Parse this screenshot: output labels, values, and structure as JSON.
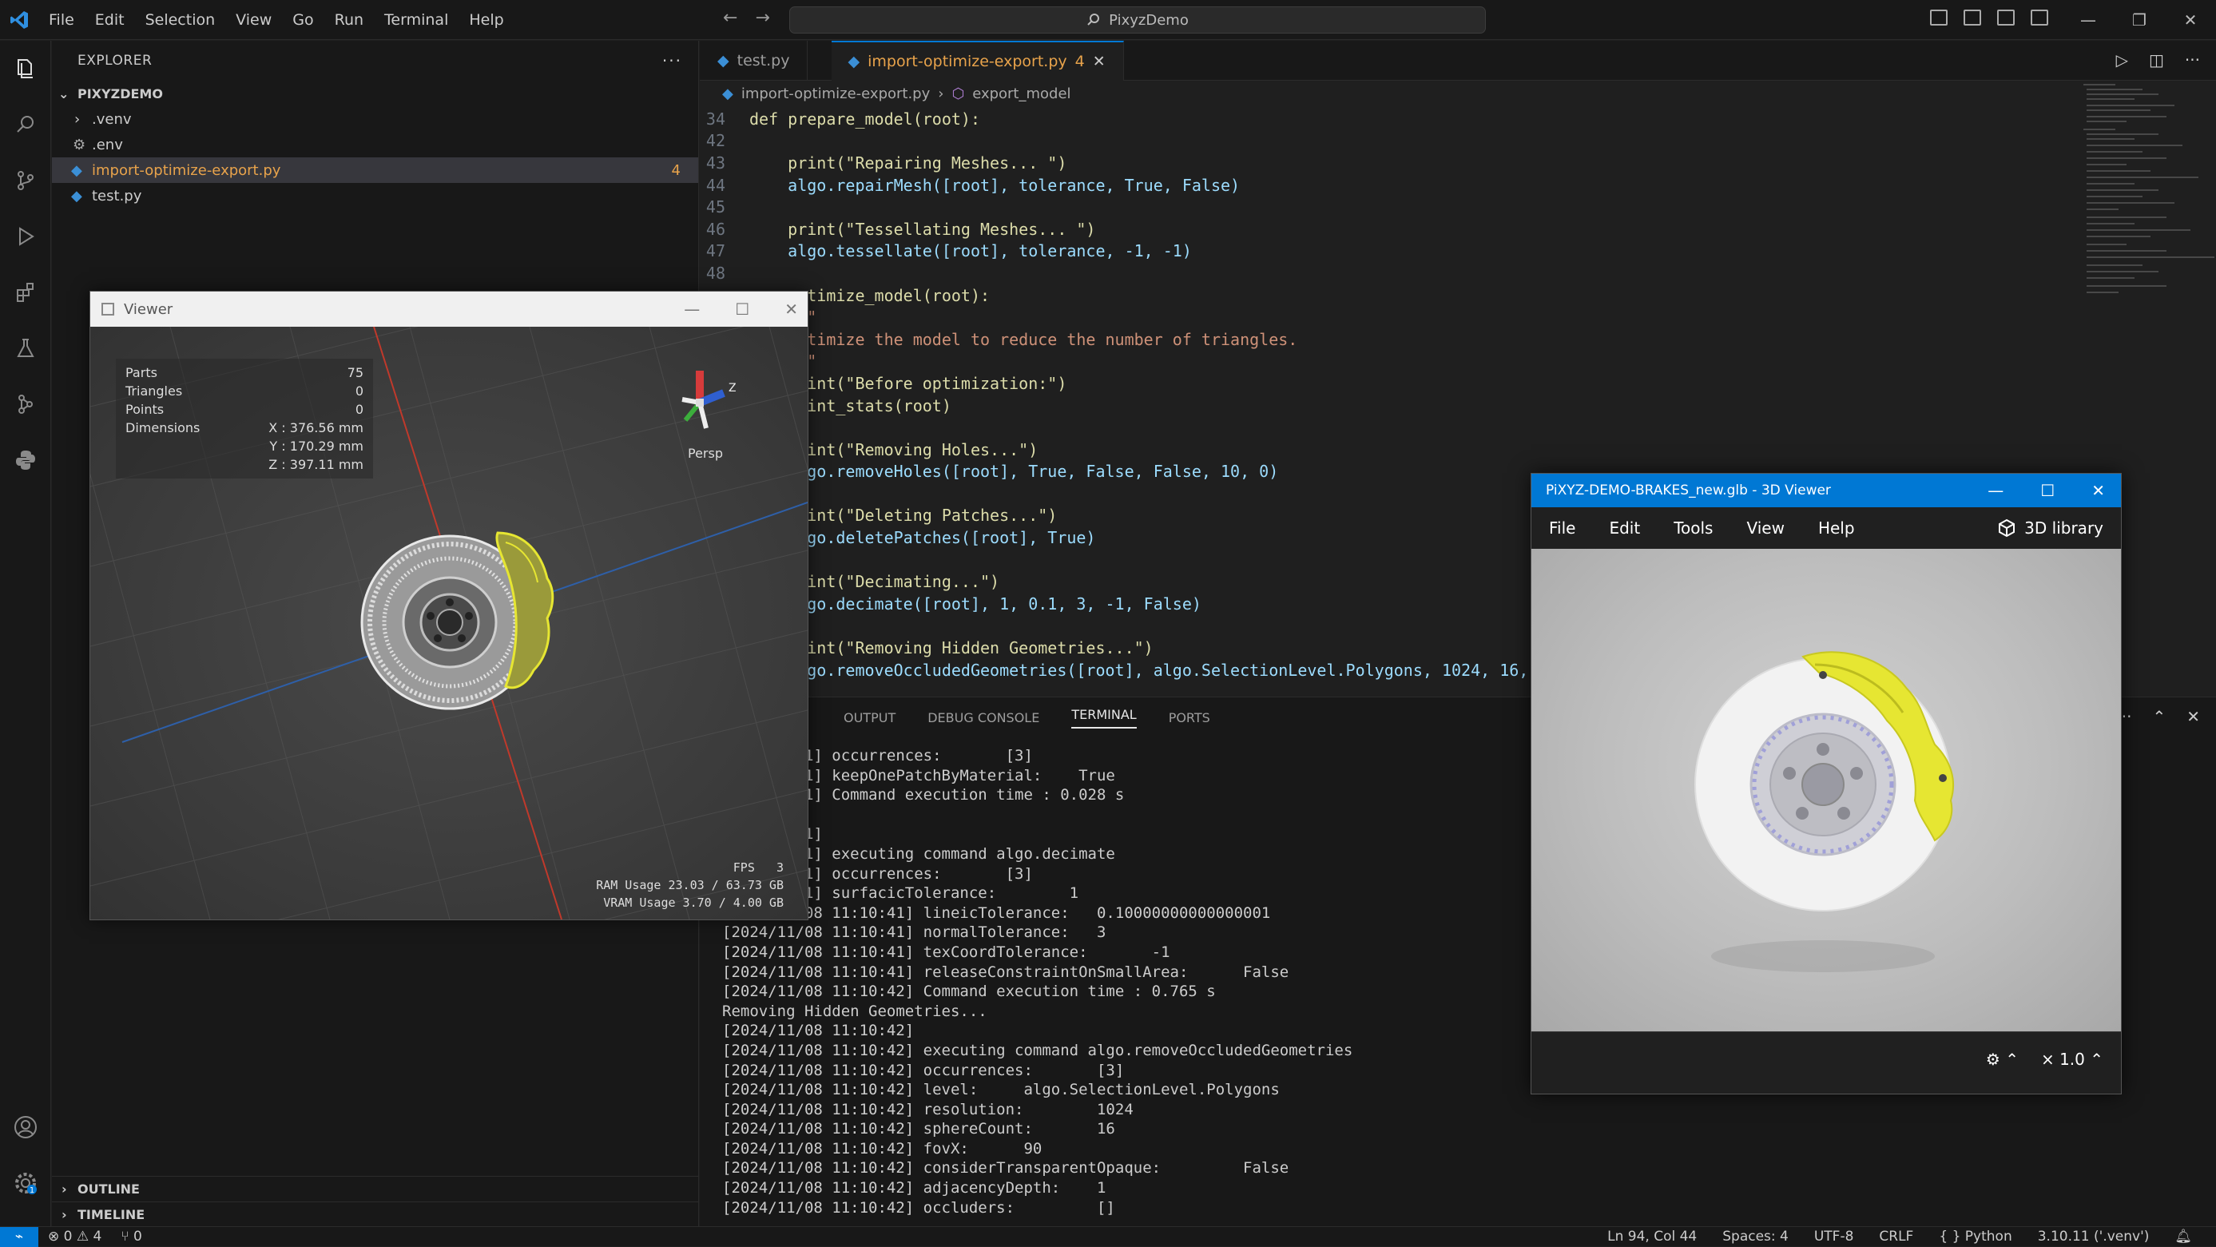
{
  "titlebar": {
    "menu": [
      "File",
      "Edit",
      "Selection",
      "View",
      "Go",
      "Run",
      "Terminal",
      "Help"
    ],
    "search_text": "PixyzDemo"
  },
  "sidebar": {
    "title": "EXPLORER",
    "project": "PIXYZDEMO",
    "items": [
      {
        "label": ".venv",
        "type": "folder"
      },
      {
        "label": ".env",
        "type": "config"
      },
      {
        "label": "import-optimize-export.py",
        "type": "python",
        "badge": "4",
        "selected": true
      },
      {
        "label": "test.py",
        "type": "python"
      }
    ],
    "outline": "OUTLINE",
    "timeline": "TIMELINE"
  },
  "editor": {
    "tabs": [
      {
        "label": "test.py"
      },
      {
        "label": "import-optimize-export.py",
        "badge": "4",
        "active": true
      }
    ],
    "breadcrumb": {
      "file": "import-optimize-export.py",
      "symbol": "export_model"
    },
    "lines": [
      {
        "n": "34",
        "t": "def prepare_model(root):"
      },
      {
        "n": "42",
        "t": ""
      },
      {
        "n": "43",
        "t": "    print(\"Repairing Meshes... \")"
      },
      {
        "n": "44",
        "t": "    algo.repairMesh([root], tolerance, True, False)"
      },
      {
        "n": "45",
        "t": ""
      },
      {
        "n": "46",
        "t": "    print(\"Tessellating Meshes... \")"
      },
      {
        "n": "47",
        "t": "    algo.tessellate([root], tolerance, -1, -1)"
      },
      {
        "n": "48",
        "t": ""
      },
      {
        "n": "",
        "t": "    optimize_model(root):"
      },
      {
        "n": "",
        "t": "    \"\"\""
      },
      {
        "n": "",
        "t": "    Optimize the model to reduce the number of triangles."
      },
      {
        "n": "",
        "t": "    \"\"\""
      },
      {
        "n": "",
        "t": "    print(\"Before optimization:\")"
      },
      {
        "n": "",
        "t": "    print_stats(root)"
      },
      {
        "n": "",
        "t": ""
      },
      {
        "n": "",
        "t": "    print(\"Removing Holes...\")"
      },
      {
        "n": "",
        "t": "    algo.removeHoles([root], True, False, False, 10, 0)"
      },
      {
        "n": "",
        "t": ""
      },
      {
        "n": "",
        "t": "    print(\"Deleting Patches...\")"
      },
      {
        "n": "",
        "t": "    algo.deletePatches([root], True)"
      },
      {
        "n": "",
        "t": ""
      },
      {
        "n": "",
        "t": "    print(\"Decimating...\")"
      },
      {
        "n": "",
        "t": "    algo.decimate([root], 1, 0.1, 3, -1, False)"
      },
      {
        "n": "",
        "t": ""
      },
      {
        "n": "",
        "t": "    print(\"Removing Hidden Geometries...\")"
      },
      {
        "n": "",
        "t": "    algo.removeOccludedGeometries([root], algo.SelectionLevel.Polygons, 1024, 16, 90,"
      }
    ]
  },
  "panel": {
    "tabs": [
      "OUTPUT",
      "DEBUG CONSOLE",
      "TERMINAL",
      "PORTS"
    ],
    "active_tab": "TERMINAL",
    "lines": [
      "8 11:10:41] occurrences:       [3]",
      "8 11:10:41] keepOnePatchByMaterial:    True",
      "8 11:10:41] Command execution time : 0.028 s",
      "..",
      "8 11:10:41]",
      "8 11:10:41] executing command algo.decimate",
      "8 11:10:41] occurrences:       [3]",
      "8 11:10:41] surfacicTolerance:        1",
      "[2024/11/08 11:10:41] lineicTolerance:   0.10000000000000001",
      "[2024/11/08 11:10:41] normalTolerance:   3",
      "[2024/11/08 11:10:41] texCoordTolerance:       -1",
      "[2024/11/08 11:10:41] releaseConstraintOnSmallArea:      False",
      "[2024/11/08 11:10:42] Command execution time : 0.765 s",
      "Removing Hidden Geometries...",
      "[2024/11/08 11:10:42]",
      "[2024/11/08 11:10:42] executing command algo.removeOccludedGeometries",
      "[2024/11/08 11:10:42] occurrences:       [3]",
      "[2024/11/08 11:10:42] level:     algo.SelectionLevel.Polygons",
      "[2024/11/08 11:10:42] resolution:        1024",
      "[2024/11/08 11:10:42] sphereCount:       16",
      "[2024/11/08 11:10:42] fovX:      90",
      "[2024/11/08 11:10:42] considerTransparentOpaque:         False",
      "[2024/11/08 11:10:42] adjacencyDepth:    1",
      "[2024/11/08 11:10:42] occluders:         []"
    ]
  },
  "statusbar": {
    "errors": "0",
    "warnings": "4",
    "ports": "0",
    "position": "Ln 94, Col 44",
    "spaces": "Spaces: 4",
    "encoding": "UTF-8",
    "eol": "CRLF",
    "language": "Python",
    "interpreter": "3.10.11 ('.venv')"
  },
  "viewer": {
    "title": "Viewer",
    "stats": [
      {
        "label": "Parts",
        "value": "75"
      },
      {
        "label": "Triangles",
        "value": "0"
      },
      {
        "label": "Points",
        "value": "0"
      },
      {
        "label": "Dimensions",
        "value": "X : 376.56 mm"
      },
      {
        "label": "",
        "value": "Y : 170.29 mm"
      },
      {
        "label": "",
        "value": "Z : 397.11 mm"
      }
    ],
    "gizmo_axis": "Z",
    "gizmo_label": "Persp",
    "fps_label": "FPS",
    "fps": "3",
    "ram": "RAM Usage  23.03 / 63.73 GB",
    "vram": "VRAM Usage  3.70 / 4.00 GB"
  },
  "viewer3d": {
    "title": "PiXYZ-DEMO-BRAKES_new.glb - 3D Viewer",
    "menu": [
      "File",
      "Edit",
      "Tools",
      "View",
      "Help"
    ],
    "library": "3D library",
    "zoom": "× 1.0"
  },
  "colors": {
    "accent": "#0078d4",
    "caliper": "#e6e632",
    "active_tab_text": "#e8a34b"
  }
}
